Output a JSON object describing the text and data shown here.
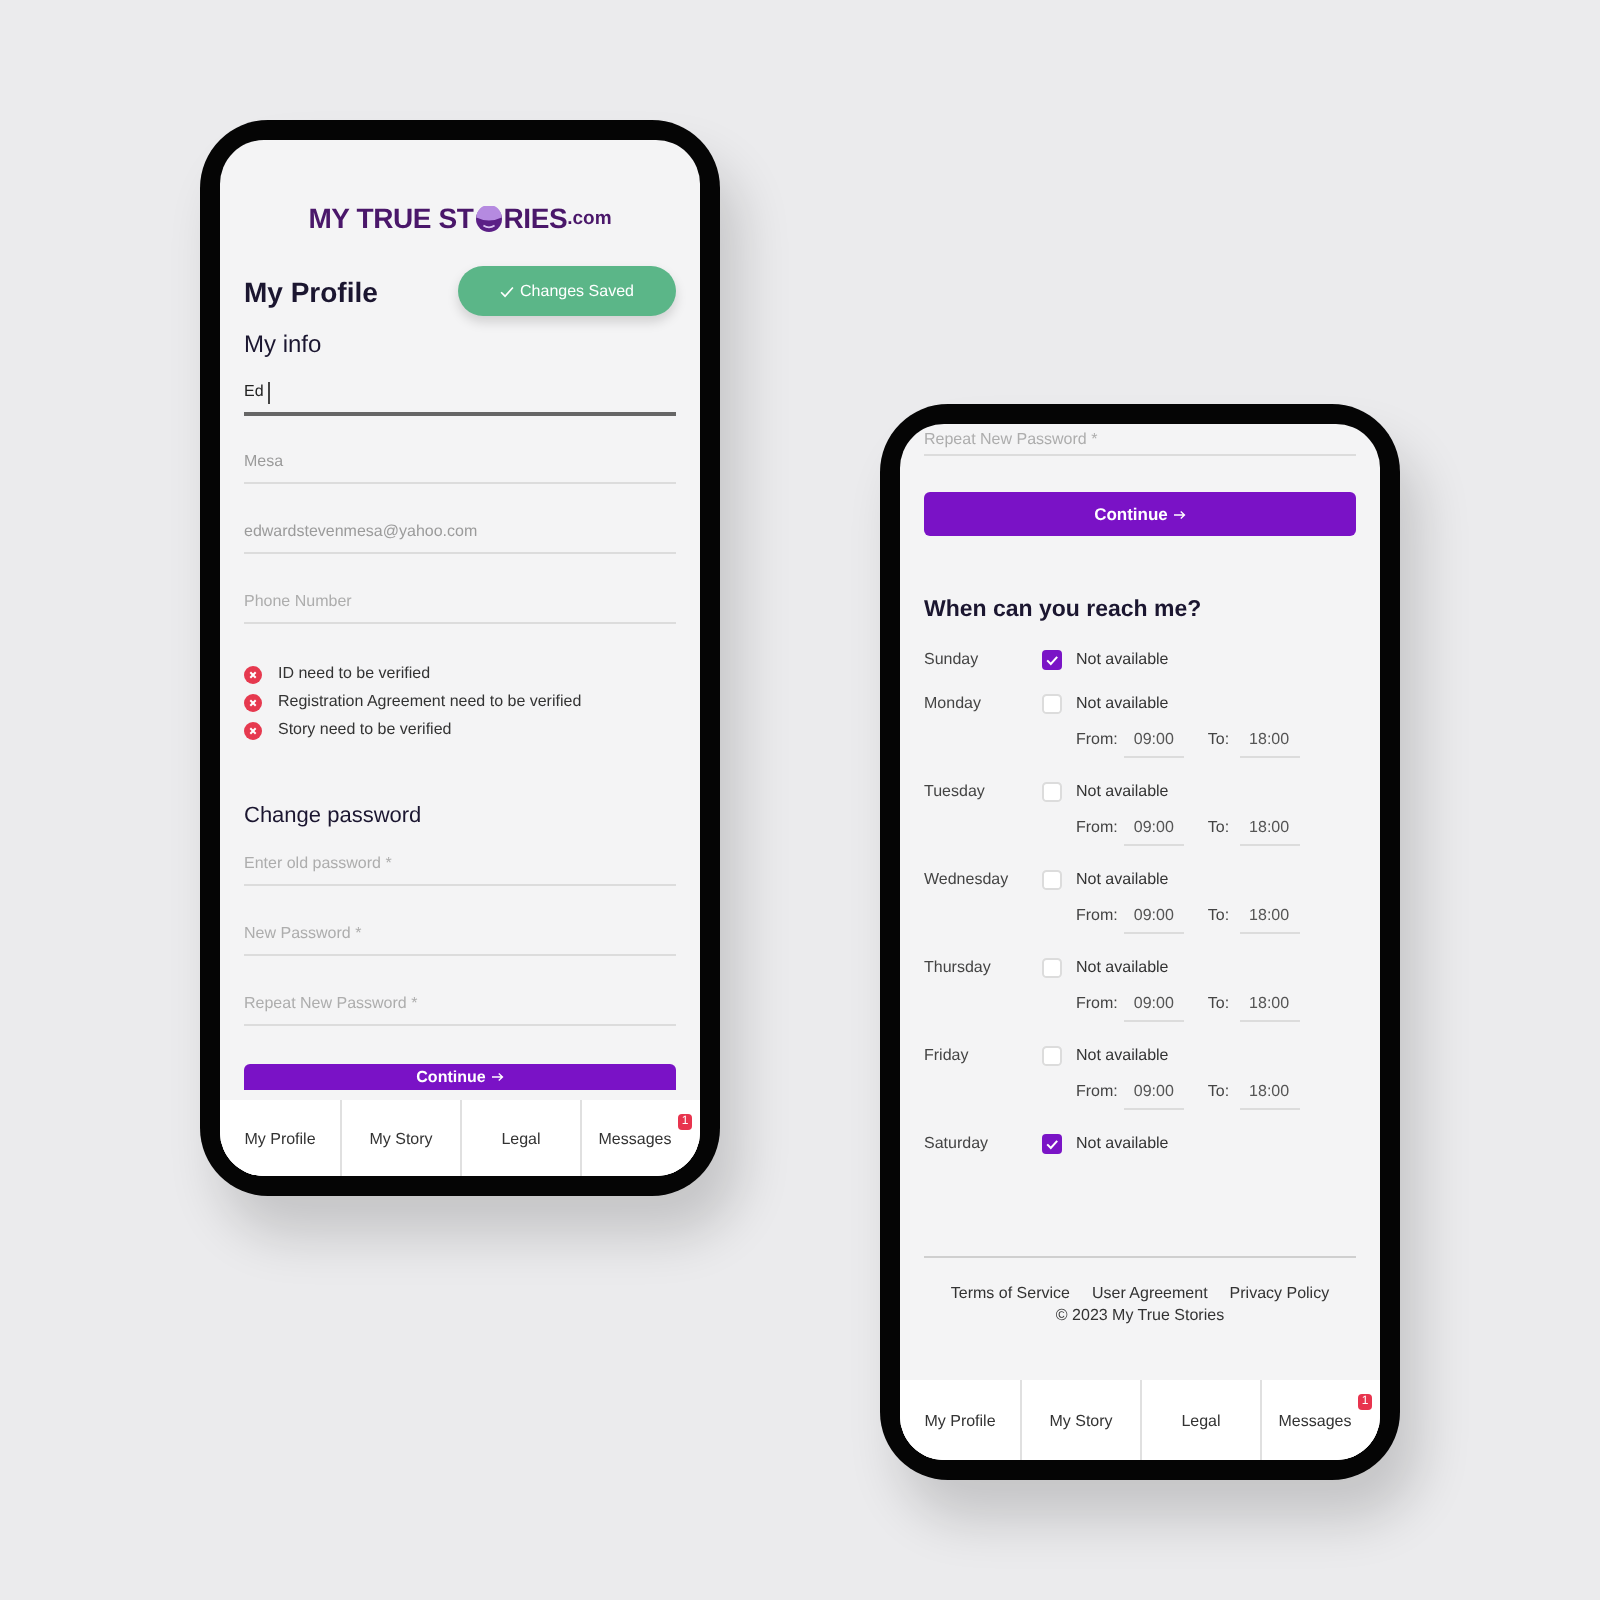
{
  "profile_phone": {
    "logo": {
      "lead": "MY TRUE ST",
      "tail": "RIES",
      "suffix": ".com"
    },
    "title": "My Profile",
    "toast": "Changes Saved",
    "info_heading": "My info",
    "info_fields": [
      {
        "value": "Ed",
        "focused": true
      },
      {
        "value": "Mesa",
        "focused": false
      },
      {
        "value": "edwardstevenmesa@yahoo.com",
        "focused": false
      },
      {
        "placeholder": "Phone Number",
        "focused": false
      }
    ],
    "warnings": [
      "ID need to be verified",
      "Registration Agreement need to be verified",
      "Story need to be verified"
    ],
    "password_heading": "Change password",
    "password_fields": [
      {
        "placeholder": "Enter old password *"
      },
      {
        "placeholder": "New Password *"
      },
      {
        "placeholder": "Repeat New Password *"
      }
    ],
    "button": "Continue",
    "nav": [
      {
        "label": "My Profile",
        "selected": false
      },
      {
        "label": "My Story",
        "selected": false
      },
      {
        "label": "Legal",
        "selected": false
      },
      {
        "label": "Messages",
        "selected": false,
        "badge": "1"
      }
    ]
  },
  "availability_phone": {
    "fields": [
      {
        "placeholder": "Repeat New Password *"
      }
    ],
    "button": "Continue",
    "heading": "When can you reach me?",
    "days": [
      {
        "day": "Sunday",
        "option": "Not available",
        "checked": true
      },
      {
        "day": "Monday",
        "option": "Not available",
        "checked": false,
        "from_label": "From:",
        "from": "09:00",
        "to_label": "To:",
        "to": "18:00"
      },
      {
        "day": "Tuesday",
        "option": "Not available",
        "checked": false,
        "from_label": "From:",
        "from": "09:00",
        "to_label": "To:",
        "to": "18:00"
      },
      {
        "day": "Wednesday",
        "option": "Not available",
        "checked": false,
        "from_label": "From:",
        "from": "09:00",
        "to_label": "To:",
        "to": "18:00"
      },
      {
        "day": "Thursday",
        "option": "Not available",
        "checked": false,
        "from_label": "From:",
        "from": "09:00",
        "to_label": "To:",
        "to": "18:00"
      },
      {
        "day": "Friday",
        "option": "Not available",
        "checked": false,
        "from_label": "From:",
        "from": "09:00",
        "to_label": "To:",
        "to": "18:00"
      },
      {
        "day": "Saturday",
        "option": "Not available",
        "checked": true
      }
    ],
    "footer_links": [
      "Terms of Service",
      "User Agreement",
      "Privacy Policy"
    ],
    "copyright": "© 2023 My True Stories",
    "nav": [
      {
        "label": "My Profile",
        "selected": false
      },
      {
        "label": "My Story",
        "selected": false
      },
      {
        "label": "Legal",
        "selected": false
      },
      {
        "label": "Messages",
        "selected": false,
        "badge": "1"
      }
    ]
  }
}
